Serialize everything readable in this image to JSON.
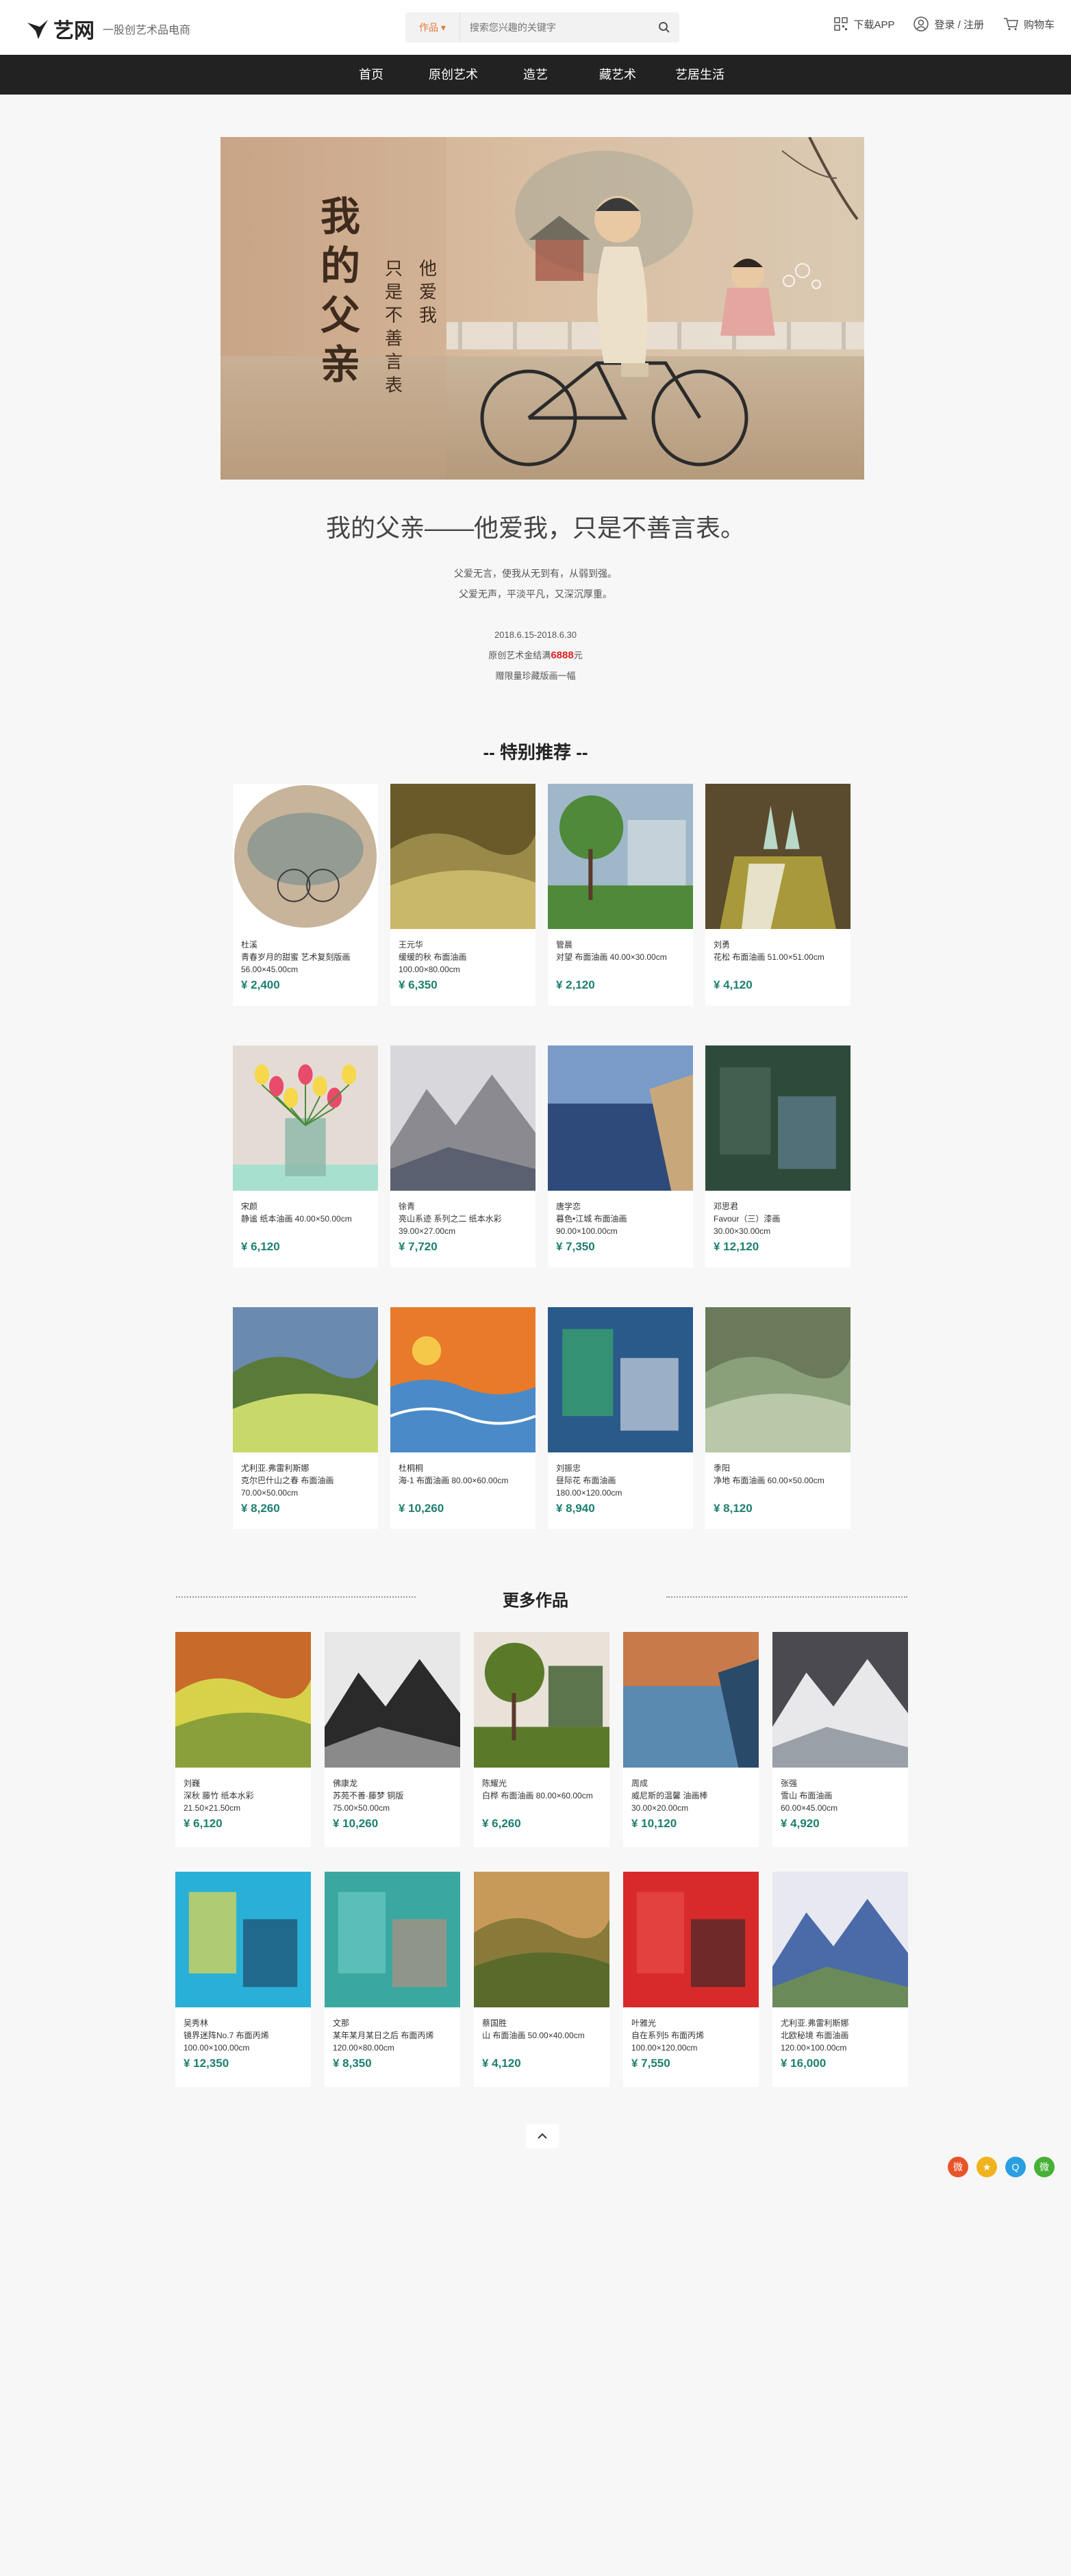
{
  "header": {
    "logo_text": "艺网",
    "tagline": "一股创艺术品电商",
    "search_category": "作品 ▾",
    "search_placeholder": "搜索您兴趣的关键字",
    "download": "下载APP",
    "login": "登录 / 注册",
    "cart": "购物车"
  },
  "nav": [
    "首页",
    "原创艺术",
    "造艺",
    "藏艺术",
    "艺居生活"
  ],
  "banner": {
    "calligraphy_main": [
      "我",
      "的",
      "父",
      "亲"
    ],
    "calligraphy_col1": [
      "他",
      "爱",
      "我"
    ],
    "calligraphy_col2": [
      "只",
      "是",
      "不",
      "善",
      "言",
      "表"
    ]
  },
  "event": {
    "title": "我的父亲——他爱我，只是不善言表。",
    "desc1": "父爱无言，使我从无到有，从弱到强。",
    "desc2": "父爱无声，平淡平凡，又深沉厚重。",
    "date": "2018.6.15-2018.6.30",
    "bonus_prefix": "原创艺术金结满",
    "bonus_amount": "6888",
    "bonus_suffix": "元",
    "gift": "赠限量珍藏版画一幅"
  },
  "special": {
    "title": "-- 特别推荐 --",
    "items": [
      {
        "line1": "杜溪",
        "line2": "青春岁月的甜蜜 艺术复刻版画",
        "line3": "56.00×45.00cm",
        "price": "¥ 2,400"
      },
      {
        "line1": "王元华",
        "line2": "缓缓的秋 布面油画",
        "line3": "100.00×80.00cm",
        "price": "¥ 6,350"
      },
      {
        "line1": "管晨",
        "line2": "对望 布面油画 40.00×30.00cm",
        "line3": "",
        "price": "¥ 2,120"
      },
      {
        "line1": "刘勇",
        "line2": "花松 布面油画 51.00×51.00cm",
        "line3": "",
        "price": "¥ 4,120"
      },
      {
        "line1": "宋颜",
        "line2": "静谧 纸本油画 40.00×50.00cm",
        "line3": "",
        "price": "¥ 6,120"
      },
      {
        "line1": "徐青",
        "line2": "亮山系迹 系列之二 纸本水彩",
        "line3": "39.00×27.00cm",
        "price": "¥ 7,720"
      },
      {
        "line1": "唐学恋",
        "line2": "暮色•江城 布面油画",
        "line3": "90.00×100.00cm",
        "price": "¥ 7,350"
      },
      {
        "line1": "邓思君",
        "line2": "Favour（三）漆画",
        "line3": "30.00×30.00cm",
        "price": "¥ 12,120"
      },
      {
        "line1": "尤利亚.弗雷利斯娜",
        "line2": "克尔巴什山之春 布面油画",
        "line3": "70.00×50.00cm",
        "price": "¥ 8,260"
      },
      {
        "line1": "杜桐桐",
        "line2": "海-1 布面油画 80.00×60.00cm",
        "line3": "",
        "price": "¥ 10,260"
      },
      {
        "line1": "刘振忠",
        "line2": "昼际花 布面油画",
        "line3": "180.00×120.00cm",
        "price": "¥ 8,940"
      },
      {
        "line1": "季阳",
        "line2": "净地 布面油画 60.00×50.00cm",
        "line3": "",
        "price": "¥ 8,120"
      }
    ]
  },
  "more": {
    "title": "更多作品",
    "items": [
      {
        "line1": "刘巍",
        "line2": "深秋 藤竹 纸本水彩",
        "line3": "21.50×21.50cm",
        "price": "¥ 6,120"
      },
      {
        "line1": "佛康龙",
        "line2": "苏苑不善·藤梦 铜版",
        "line3": "75.00×50.00cm",
        "price": "¥ 10,260"
      },
      {
        "line1": "陈耀光",
        "line2": "白桦 布面油画 80.00×60.00cm",
        "line3": "",
        "price": "¥ 6,260"
      },
      {
        "line1": "周成",
        "line2": "威尼斯的温馨 油画棒",
        "line3": "30.00×20.00cm",
        "price": "¥ 10,120"
      },
      {
        "line1": "张强",
        "line2": "雪山 布面油画",
        "line3": "60.00×45.00cm",
        "price": "¥ 4,920"
      },
      {
        "line1": "吴秀林",
        "line2": "镜界迷阵No.7 布面丙烯",
        "line3": "100.00×100.00cm",
        "price": "¥ 12,350"
      },
      {
        "line1": "文那",
        "line2": "某年某月某日之后 布面丙烯",
        "line3": "120.00×80.00cm",
        "price": "¥ 8,350"
      },
      {
        "line1": "蔡国胜",
        "line2": "山 布面油画 50.00×40.00cm",
        "line3": "",
        "price": "¥ 4,120"
      },
      {
        "line1": "叶雅光",
        "line2": "自在系列5 布面丙烯",
        "line3": "100.00×120.00cm",
        "price": "¥ 7,550"
      },
      {
        "line1": "尤利亚.弗雷利斯娜",
        "line2": "北欧秘境 布面油画",
        "line3": "120.00×100.00cm",
        "price": "¥ 16,000"
      }
    ]
  },
  "share": [
    {
      "name": "weibo-icon",
      "color": "#e8542a",
      "glyph": "微"
    },
    {
      "name": "qzone-icon",
      "color": "#f0b31d",
      "glyph": "★"
    },
    {
      "name": "qq-icon",
      "color": "#2a9fe0",
      "glyph": "Q"
    },
    {
      "name": "wechat-icon",
      "color": "#45b035",
      "glyph": "微"
    }
  ]
}
